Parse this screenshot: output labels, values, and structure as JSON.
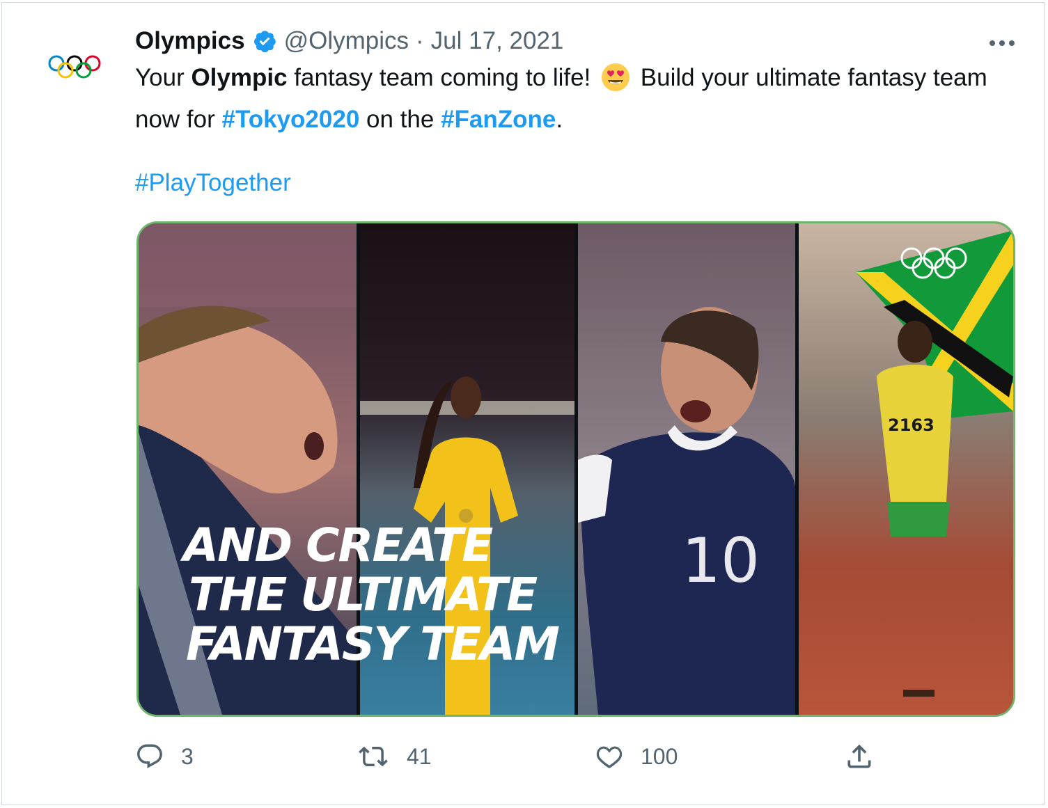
{
  "tweet": {
    "author_name": "Olympics",
    "handle": "@Olympics",
    "separator": "·",
    "date": "Jul 17, 2021",
    "text_part1": "Your ",
    "text_bold": "Olympic",
    "text_part2": " fantasy team coming to life! ",
    "text_part3": " Build your ultimate fantasy team now for ",
    "hashtag1": "#Tokyo2020",
    "text_part4": " on the ",
    "hashtag2": "#FanZone",
    "text_part5": ".",
    "hashtag3": "#PlayTogether"
  },
  "media": {
    "overlay_line1": "AND CREATE",
    "overlay_line2": "THE ULTIMATE",
    "overlay_line3": "FANTASY TEAM",
    "jersey_number": "10",
    "bib_number": "2163"
  },
  "actions": {
    "reply_count": "3",
    "retweet_count": "41",
    "like_count": "100"
  },
  "icons": {
    "avatar": "olympic-rings-icon",
    "verified": "verified-badge-icon",
    "more": "more-icon",
    "emoji": "heart-eyes-emoji",
    "reply": "reply-icon",
    "retweet": "retweet-icon",
    "like": "heart-icon",
    "share": "share-icon"
  },
  "colors": {
    "link": "#1d9bf0",
    "muted": "#536471",
    "text": "#0f1419",
    "media_border": "#6fb56a"
  }
}
